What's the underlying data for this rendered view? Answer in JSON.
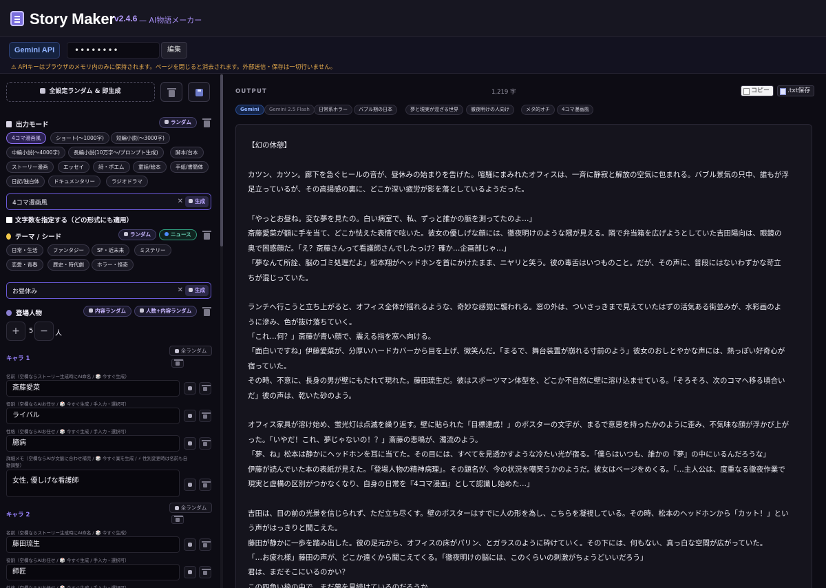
{
  "header": {
    "title": "Story Maker",
    "version": "v2.4.6",
    "subtitle": "— AI物語メーカー"
  },
  "api": {
    "label": "Gemini API",
    "key_value": "••••••••",
    "edit_label": "編集",
    "warning": "⚠ APIキーはブラウザのメモリ内のみに保持されます。ページを閉じると消去されます。外部送信・保存は一切行いません。"
  },
  "left": {
    "random_all_label": "全設定ランダム & 即生成",
    "output_mode": {
      "title": "出力モード",
      "random_label": "ランダム",
      "chips": [
        "4コマ漫画風",
        "ショート(〜1000字)",
        "短編小説(〜3000字)",
        "中編小説(〜4000字)",
        "長編小説(10万字〜/プロンプト生成)",
        "脚本/台本",
        "ストーリー漫画",
        "エッセイ",
        "詩・ポエム",
        "童話/絵本",
        "手紙/書簡体",
        "日記/独白体",
        "ドキュメンタリー",
        "ラジオドラマ"
      ],
      "selected": 0,
      "field_value": "4コマ漫画風",
      "generate_label": "生成",
      "clear_symbol": "✕"
    },
    "char_count_label": "文字数を指定する（どの形式にも適用）",
    "theme": {
      "title": "テーマ / シード",
      "random_label": "ランダム",
      "news_label": "ニュース",
      "chips": [
        "日常・生活",
        "ファンタジー",
        "SF・近未来",
        "ミステリー",
        "恋愛・青春",
        "歴史・時代劇",
        "ホラー・怪奇"
      ],
      "field_value": "お昼休み",
      "generate_label": "生成",
      "clear_symbol": "✕"
    },
    "characters": {
      "title": "登場人物",
      "content_random_label": "内容ランダム",
      "count_random_label": "人数+内容ランダム",
      "count": "5",
      "unit": "人",
      "plus": "+",
      "minus": "−",
      "all_random_label": "全ランダム",
      "name_label": "名前（空欄ならストーリー生成時にAI命名 / 🎲 今すぐ生成）",
      "role_label": "役割（空欄ならAIお任せ / 🎲 今すぐ生成 / 手入力・選択可）",
      "personality_label": "性格（空欄ならAIお任せ / 🎲 今すぐ生成 / 手入力・選択可）",
      "memo_label_1": "詳細メモ（空欄ならAIが文脈に合わせ補完 / 🎲 今すぐ案を生成 / ⚡ 性別変更時は名前も自",
      "memo_label_2": "動調整）",
      "list": [
        {
          "heading": "キャラ 1",
          "name": "斎藤愛菜",
          "role": "ライバル",
          "personality": "臆病",
          "memo": "女性, 優しげな看護師"
        },
        {
          "heading": "キャラ 2",
          "name": "藤田琉生",
          "role": "師匠",
          "personality": "",
          "memo": ""
        }
      ]
    }
  },
  "output": {
    "label": "OUTPUT",
    "char_count": "1,219 字",
    "copy_label": "コピー",
    "save_label": ".txt保存",
    "tags": [
      "Gemini",
      "Gemini 2.5 Flash",
      "日常系ホラー",
      "バブル期の日本",
      "夢と現実が混ざる世界",
      "徹夜明けの人向け",
      "メタ的オチ",
      "4コマ漫画風"
    ],
    "lines": [
      "【幻の休憩】",
      "",
      "カツン、カツン。廊下を急ぐヒールの音が、昼休みの始まりを告げた。喧騒にまみれたオフィスは、一斉に静寂と解放の空気に包まれる。バブル景気の只中、誰もが浮",
      "足立っているが、その高揚感の裏に、どこか深い疲労が影を落としているようだった。",
      "",
      "「やっとお昼ね。変な夢を見たの。白い病室で、私、ずっと誰かの脈を測ってたのよ…」",
      "斎藤愛菜が額に手を当て、どこか怯えた表情で呟いた。彼女の優しげな顔には、徹夜明けのような隈が見える。隣で弁当箱を広げようとしていた吉田陽向は、眼鏡の",
      "奥で困惑顔だ。「え？斎藤さんって看護師さんでしたっけ？確か…企画部じゃ…」",
      "「夢なんて所詮、脳のゴミ処理だよ」松本翔がヘッドホンを首にかけたまま、ニヤリと笑う。彼の毒舌はいつものこと。だが、その声に、普段にはないわずかな苛立",
      "ちが混じっていた。",
      "",
      "ランチへ行こうと立ち上がると、オフィス全体が揺れるような、奇妙な感覚に襲われる。窓の外は、ついさっきまで見えていたはずの活気ある街並みが、水彩画のよ",
      "うに滲み、色が抜け落ちていく。",
      "「これ…何？」斎藤が青い顔で、震える指を窓へ向ける。",
      "「面白いですね」伊藤愛菜が、分厚いハードカバーから目を上げ、微笑んだ。「まるで、舞台装置が崩れる寸前のよう」彼女のおしとやかな声には、熱っぽい好奇心が",
      "宿っていた。",
      "その時、不意に、長身の男が壁にもたれて現れた。藤田琉生だ。彼はスポーツマン体型を、どこか不自然に壁に溶け込ませている。「そろそろ、次のコマへ移る頃合い",
      "だ」彼の声は、乾いた砂のよう。",
      "",
      "オフィス家具が溶け始め、蛍光灯は点滅を繰り返す。壁に貼られた「目標達成！」のポスターの文字が、まるで意思を持ったかのように歪み、不気味な顔が浮かび上が",
      "った。「いやだ！これ、夢じゃないの！？」斎藤の悲鳴が、濁流のよう。",
      "「夢、ね」松本は静かにヘッドホンを耳に当てた。その目には、すべてを見透かすような冷たい光が宿る。「僕らはいつも、誰かの『夢』の中にいるんだろうな」",
      "伊藤が読んでいた本の表紙が見えた。「登場人物の精神病理」。その題名が、今の状況を嘲笑うかのようだ。彼女はページをめくる。「…主人公は、度重なる徹夜作業で",
      "現実と虚構の区別がつかなくなり、自身の日常を『4コマ漫画』として認識し始めた…」",
      "",
      "吉田は、目の前の光景を信じられず、ただ立ち尽くす。壁のポスターはすでに人の形を為し、こちらを凝視している。その時、松本のヘッドホンから「カット！」とい",
      "う声がはっきりと聞こえた。",
      "藤田が静かに一歩を踏み出した。彼の足元から、オフィスの床がパリン、とガラスのように砕けていく。その下には、何もない、真っ白な空間が広がっていた。",
      "「…お疲れ様」藤田の声が、どこか遠くから聞こえてくる。「徹夜明けの脳には、このくらいの刺激がちょうどいいだろう」",
      "君は、まだそこにいるのかい？",
      "この四角い枠の中で、まだ夢を見続けているのだろうか。"
    ]
  },
  "colors": {
    "background": "#0d0c14",
    "accent": "#8b6ff0",
    "news": "#6fe0c0",
    "warning": "#e3a94b"
  }
}
